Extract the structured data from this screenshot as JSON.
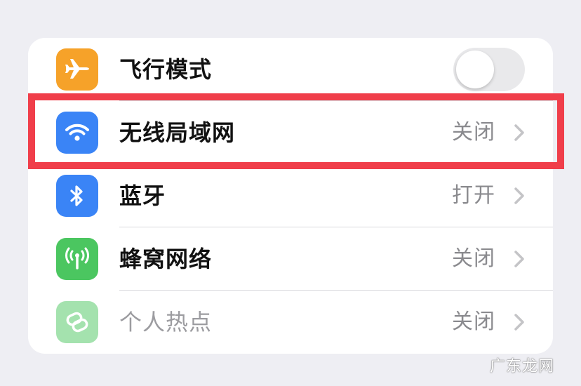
{
  "settings": {
    "rows": [
      {
        "label": "飞行模式",
        "icon": "airplane-icon",
        "icon_color": "#f6a229",
        "toggle_on": false
      },
      {
        "label": "无线局域网",
        "icon": "wifi-icon",
        "icon_color": "#3a84f6",
        "value": "关闭"
      },
      {
        "label": "蓝牙",
        "icon": "bluetooth-icon",
        "icon_color": "#3a84f6",
        "value": "打开"
      },
      {
        "label": "蜂窝网络",
        "icon": "cellular-icon",
        "icon_color": "#4bc660",
        "value": "关闭"
      },
      {
        "label": "个人热点",
        "icon": "hotspot-icon",
        "icon_color": "#4bc660",
        "value": "关闭"
      }
    ]
  },
  "highlight_color": "#f03e4a",
  "watermark": "广东龙网"
}
